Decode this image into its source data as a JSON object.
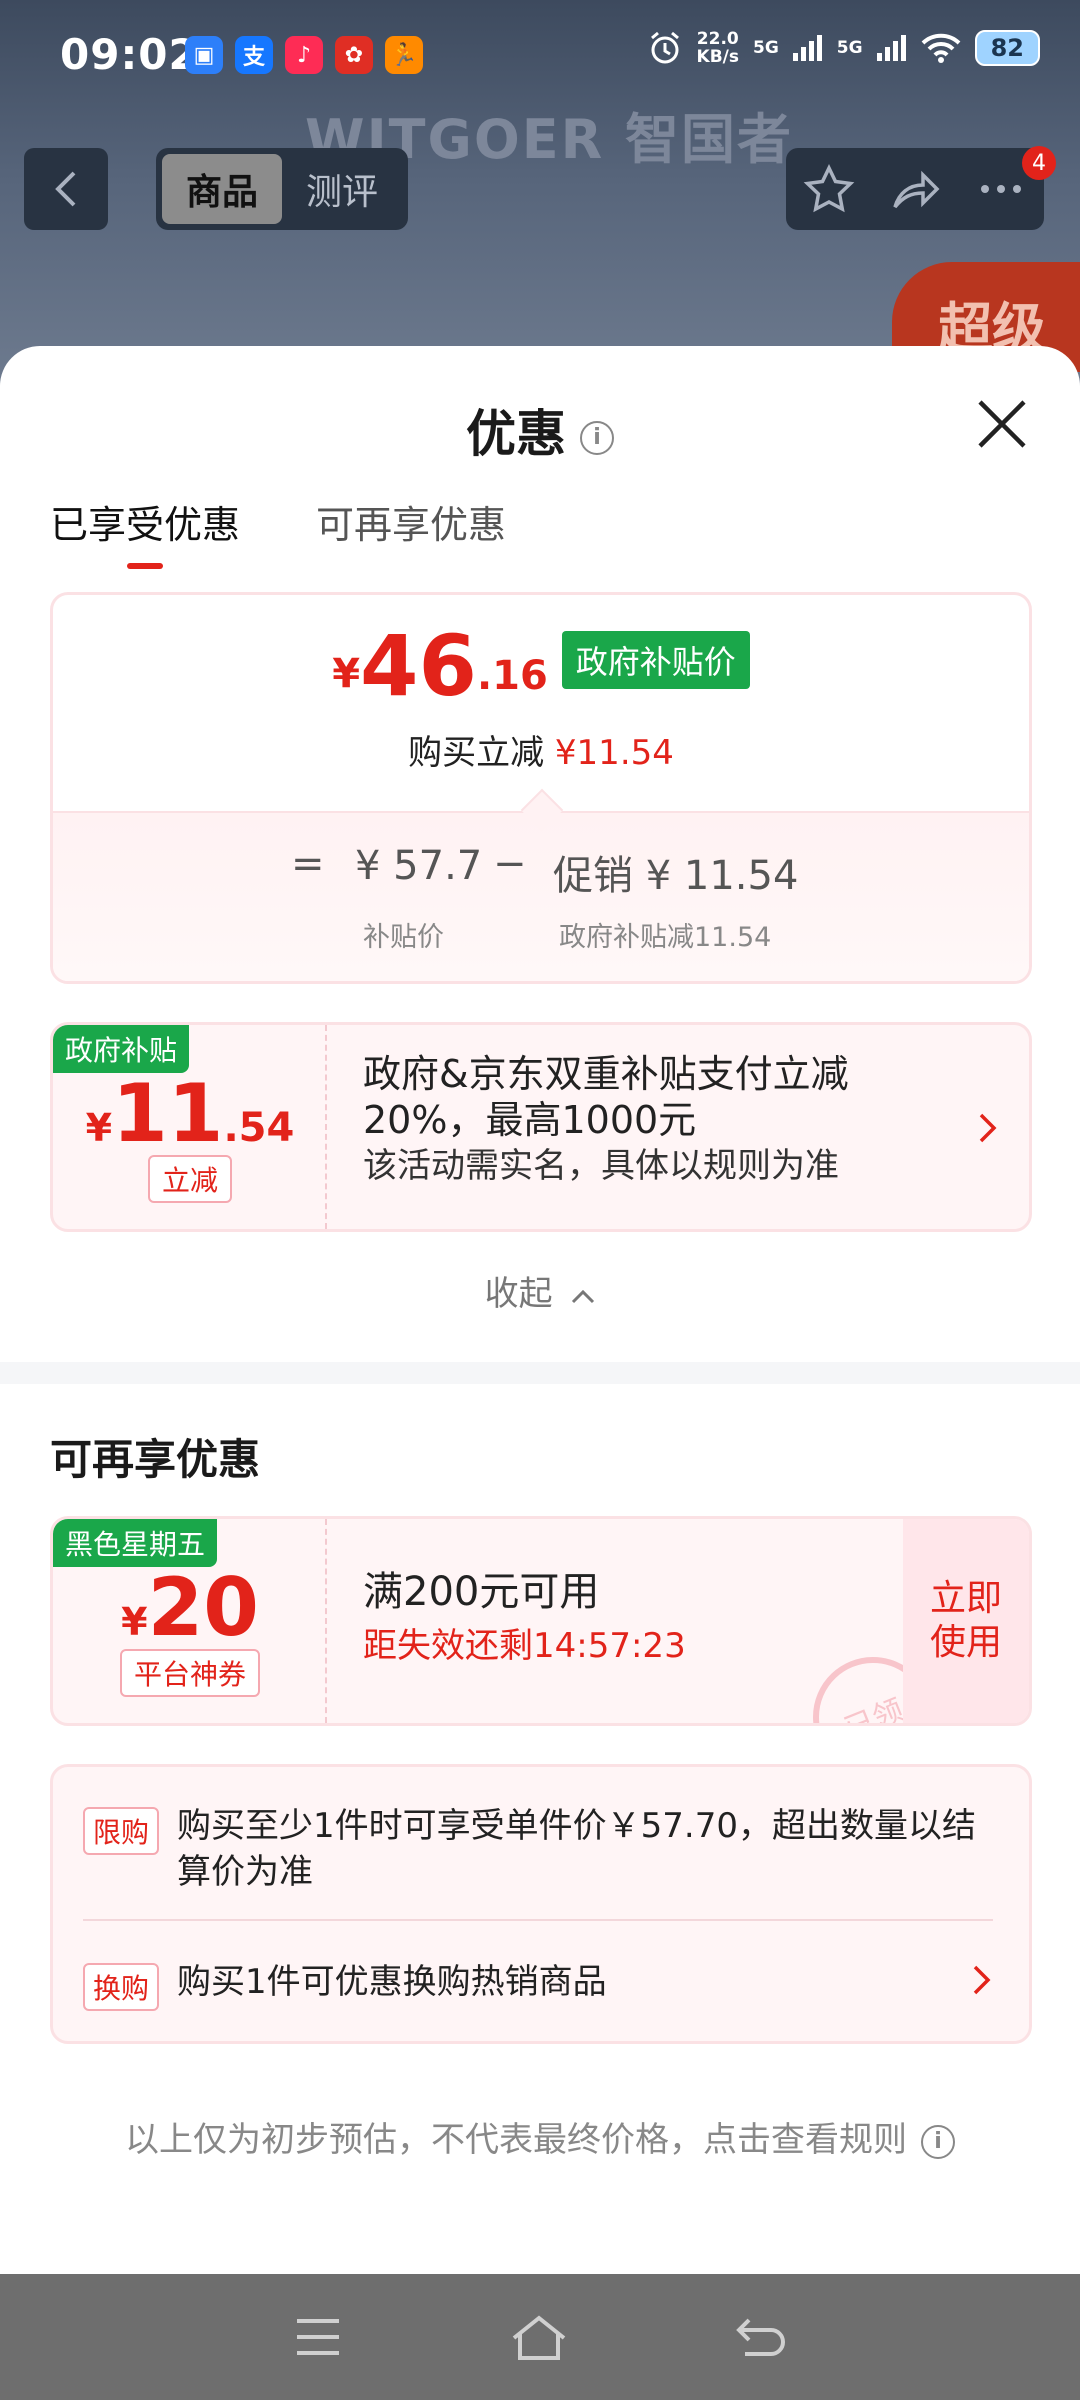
{
  "status_bar": {
    "time": "09:02",
    "net_speed_value": "22.0",
    "net_speed_unit": "KB/s",
    "signal_1": "5G",
    "signal_2": "5G",
    "battery": "82"
  },
  "background_page": {
    "brand_text": "WITGOER 智国者",
    "tabs": [
      "商品",
      "测评"
    ],
    "active_tab": "商品",
    "more_badge": "4",
    "promo_tag": "超级"
  },
  "sheet": {
    "title": "优惠",
    "tabs": [
      {
        "label": "已享受优惠",
        "active": true
      },
      {
        "label": "可再享优惠",
        "active": false
      }
    ]
  },
  "price_card": {
    "currency": "¥",
    "final_int": "46",
    "final_dec": ".16",
    "price_tag": "政府补贴价",
    "instant_cut_label": "购买立减",
    "instant_cut_value": "¥11.54",
    "formula": {
      "equals": "=",
      "base_value": "¥ 57.7",
      "base_label": "补贴价",
      "minus": "−",
      "promo_value": "促销 ¥ 11.54",
      "promo_label": "政府补贴减11.54"
    }
  },
  "subsidy_coupon": {
    "tag": "政府补贴",
    "currency": "¥",
    "amount_int": "11",
    "amount_dec": ".54",
    "sub_tag": "立减",
    "title": "政府&京东双重补贴支付立减20%，最高1000元",
    "note": "该活动需实名，具体以规则为准"
  },
  "collapse_label": "收起",
  "more_section": {
    "title": "可再享优惠",
    "coupon": {
      "tag": "黑色星期五",
      "currency": "¥",
      "amount": "20",
      "sub_tag": "平台神券",
      "condition": "满200元可用",
      "countdown": "距失效还剩14:57:23",
      "action": "立即使用",
      "stamp": "已领"
    }
  },
  "limits": [
    {
      "tag": "限购",
      "text": "购买至少1件时可享受单件价￥57.70，超出数量以结算价为准"
    },
    {
      "tag": "换购",
      "text": "购买1件可优惠换购热销商品"
    }
  ],
  "footer_note": "以上仅为初步预估，不代表最终价格，点击查看规则",
  "colors": {
    "accent_red": "#e2231a",
    "gov_green": "#1aa74a",
    "card_border": "#fbe1e4"
  }
}
